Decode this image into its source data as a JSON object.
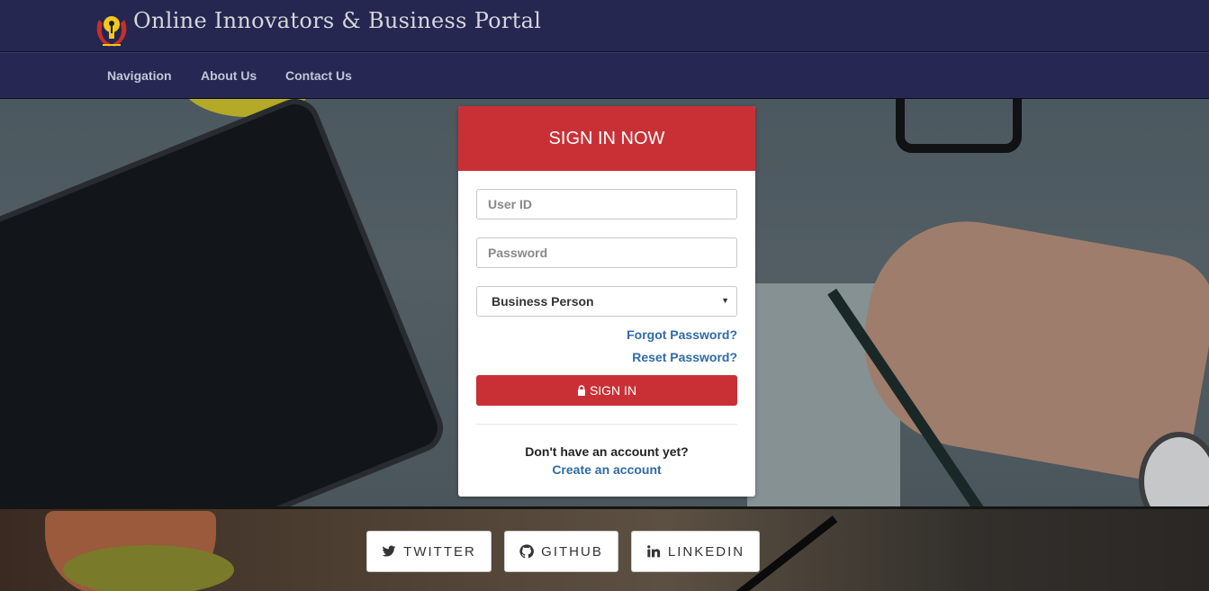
{
  "header": {
    "site_title": "Online Innovators & Business Portal",
    "logo_icon": "lightbulb-hands-logo"
  },
  "nav": {
    "items": [
      {
        "label": "Navigation"
      },
      {
        "label": "About Us"
      },
      {
        "label": "Contact Us"
      }
    ]
  },
  "login": {
    "heading": "SIGN IN NOW",
    "user_id_placeholder": "User ID",
    "password_placeholder": "Password",
    "role_selected": "Business Person",
    "forgot_password": "Forgot Password?",
    "reset_password": "Reset Password?",
    "signin_label": "SIGN IN",
    "signin_icon": "lock-icon",
    "no_account_text": "Don't have an account yet?",
    "create_account": "Create an account"
  },
  "social": [
    {
      "label": "TWITTER",
      "icon": "twitter-icon"
    },
    {
      "label": "GITHUB",
      "icon": "github-icon"
    },
    {
      "label": "LINKEDIN",
      "icon": "linkedin-icon"
    }
  ],
  "colors": {
    "header_bg": "#252750",
    "accent_red": "#c93036",
    "link_blue": "#2f6aa6"
  }
}
